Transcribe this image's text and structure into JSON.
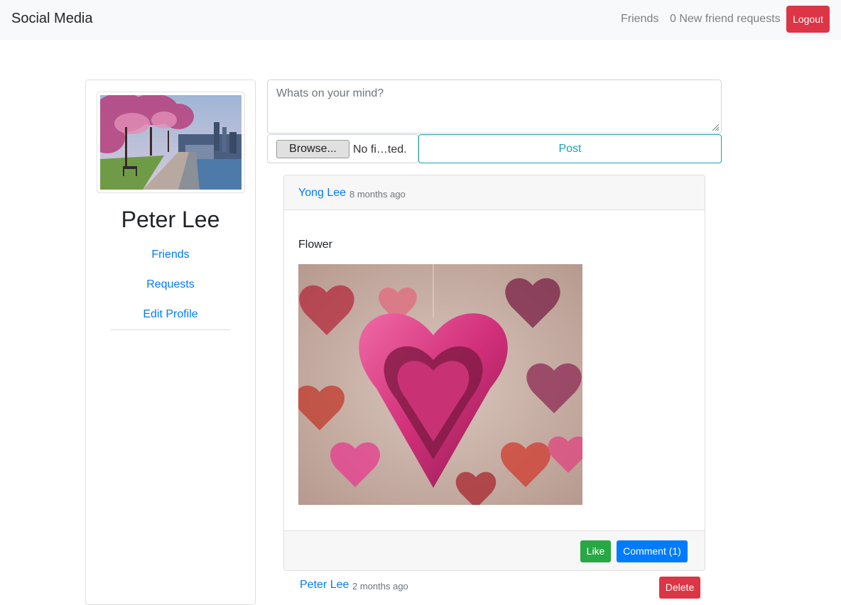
{
  "navbar": {
    "brand": "Social Media",
    "friends_link": "Friends",
    "requests_link": "0 New friend requests",
    "logout_label": "Logout"
  },
  "sidebar": {
    "profile_name": "Peter Lee",
    "links": [
      "Friends",
      "Requests",
      "Edit Profile"
    ]
  },
  "composer": {
    "placeholder": "Whats on your mind?",
    "browse_label": "Browse...",
    "file_status": "No fi…ted.",
    "post_label": "Post"
  },
  "posts": [
    {
      "author": "Yong Lee",
      "time": "8 months ago",
      "text": "Flower",
      "like_label": "Like",
      "comment_label": "Comment (1)"
    },
    {
      "author": "Peter Lee",
      "time": "2 months ago",
      "delete_label": "Delete"
    }
  ],
  "colors": {
    "primary": "#007bff",
    "danger": "#dc3545",
    "success": "#28a745",
    "info": "#17a2b8"
  }
}
